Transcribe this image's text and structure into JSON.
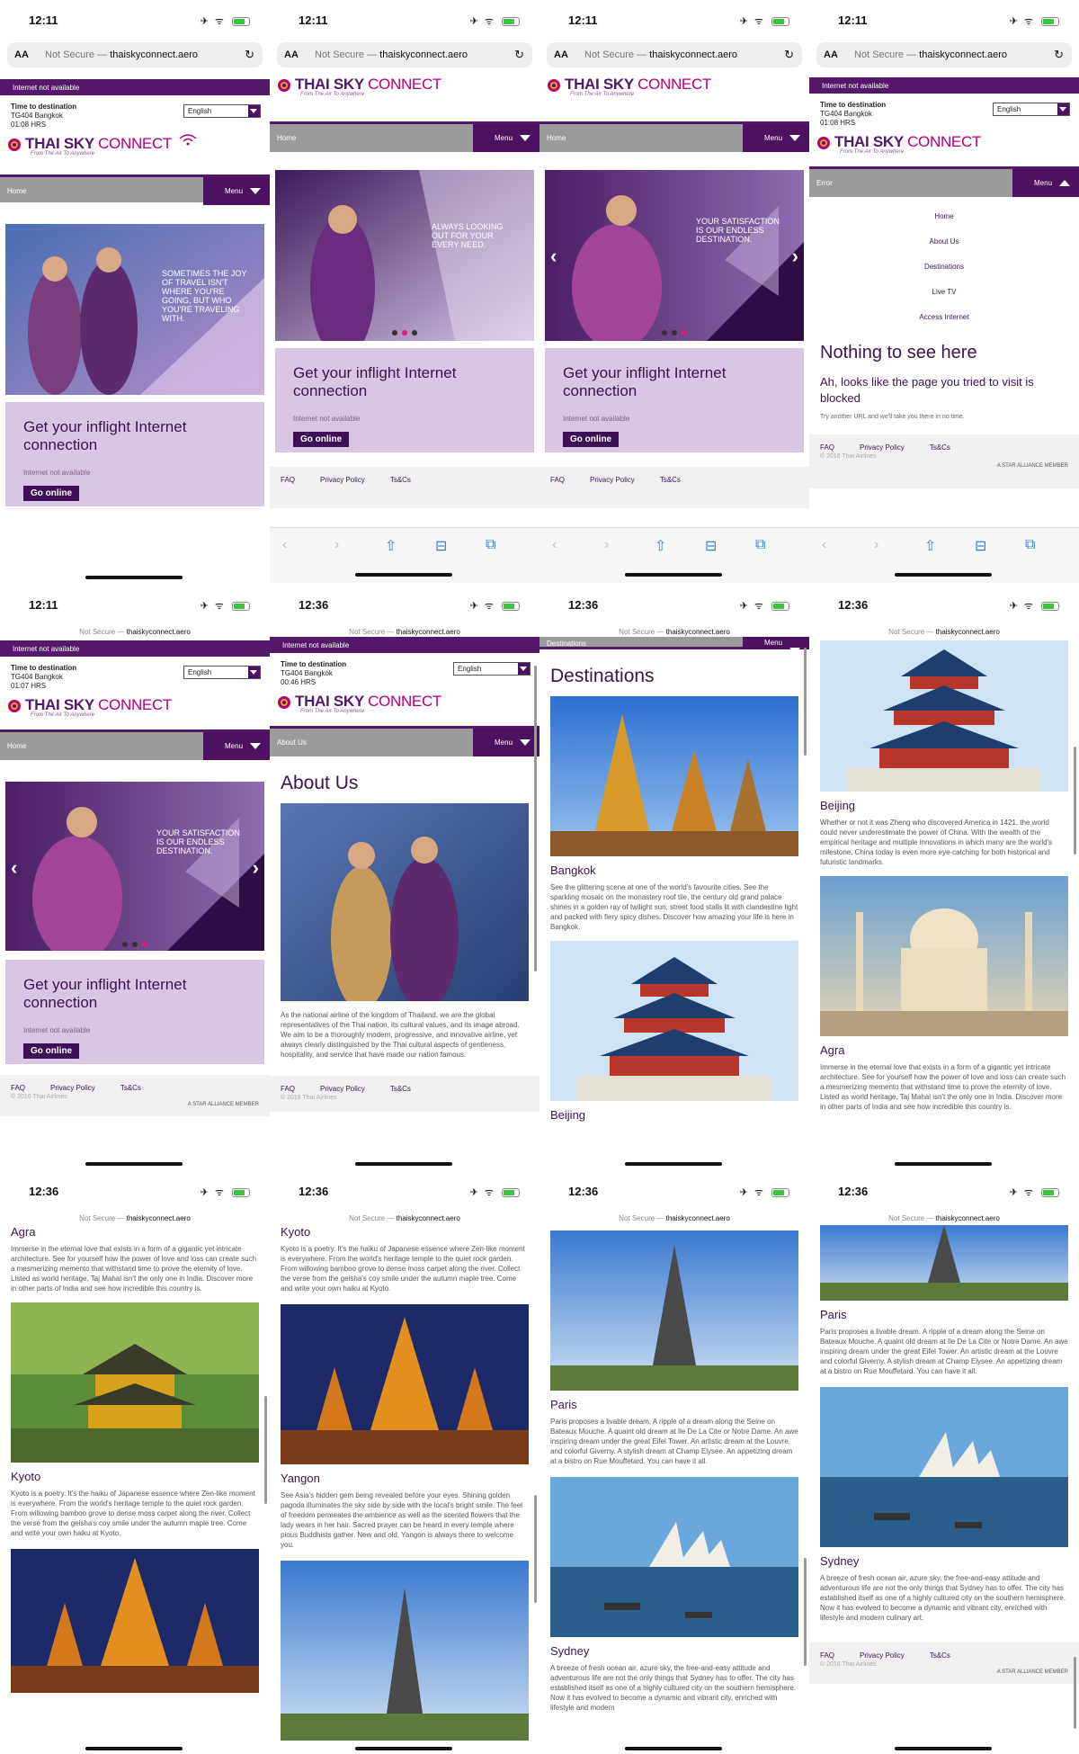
{
  "browser": {
    "not_secure": "Not Secure —",
    "domain": "thaiskyconnect.aero",
    "aa": "AA"
  },
  "status_times": {
    "s1": "12:11",
    "s5": "12:11",
    "s6": "12:36",
    "s7": "12:36",
    "s8": "12:36",
    "s9": "12:36",
    "s10": "12:36",
    "s11": "12:36",
    "s12": "12:36"
  },
  "site": {
    "internet_status": "Internet not available",
    "time_label": "Time to destination",
    "flight": "TG404 Bangkok",
    "hrs_1": "01:08 HRS",
    "hrs_5": "01:07 HRS",
    "hrs_6": "00:46 HRS",
    "language": "English",
    "logo_thai": "THAI SKY ",
    "logo_connect": "CONNECT",
    "logo_tagline": "From The Air To Anywhere",
    "menu": "Menu",
    "crumb_home": "Home",
    "crumb_error": "Error",
    "crumb_about": "About Us",
    "crumb_destinations": "Destinations"
  },
  "hero": {
    "slide1": "Sometimes the joy of travel isn't where you're going, but who you're traveling with.",
    "slide2": "Always looking out for your every need.",
    "slide3": "Your satisfaction is our endless destination."
  },
  "promo": {
    "heading": "Get your inflight Internet connection",
    "status": "Internet not available",
    "button": "Go online"
  },
  "footer": {
    "faq": "FAQ",
    "privacy": "Privacy Policy",
    "terms": "Ts&Cs",
    "copyright": "© 2016 Thai Airlines",
    "alliance": "A STAR ALLIANCE MEMBER"
  },
  "error_menu": [
    "Home",
    "About Us",
    "Destinations",
    "Live TV",
    "Access Internet"
  ],
  "error": {
    "title": "Nothing to see here",
    "message": "Ah, looks like the page you tried to visit is blocked",
    "hint": "Try another URL and we'll take you there in no time."
  },
  "about": {
    "title": "About Us",
    "text": "As the national airline of the kingdom of Thailand, we are the global representatives of the Thai nation, its cultural values, and its image abroad. We aim to be a thoroughly modern, progressive, and innovative airline, yet always clearly distinguished by the Thai cultural aspects of gentleness, hospitality, and service that have made our nation famous."
  },
  "destinations": {
    "title": "Destinations",
    "bangkok": {
      "name": "Bangkok",
      "text": "See the glittering scene at one of the world's favourite cities. See the sparkling mosaic on the monastery roof tile, the century old grand palace shines in a golden ray of twilight sun, street food stalls lit with clandestine light and packed with fiery spicy dishes. Discover how amazing your life is here in Bangkok."
    },
    "beijing": {
      "name": "Beijing",
      "text": "Whether or not it was Zheng who discovered America in 1421, the world could never underestimate the power of China. With the wealth of the empirical heritage and multiple innovations in which many are the world's milestone, China today is even more eye-catching for both historical and futuristic landmarks."
    },
    "agra": {
      "name": "Agra",
      "text": "Immerse in the eternal love that exists in a form of a gigantic yet intricate architecture. See for yourself how the power of love and loss can create such a mesmerizing memento that withstand time to prove the eternity of love. Listed as world heritage, Taj Mahal isn't the only one in India. Discover more in other parts of India and see how incredible this country is."
    },
    "kyoto": {
      "name": "Kyoto",
      "text": "Kyoto is a poetry. It's the haiku of Japanese essence where Zen-like moment is everywhere. From the world's heritage temple to the quiet rock garden. From willowing bamboo grove to dense moss carpet along the river. Collect the verse from the geisha's coy smile under the autumn maple tree. Come and write your own haiku at Kyoto."
    },
    "yangon": {
      "name": "Yangon",
      "text": "See Asia's hidden gem being revealed before your eyes. Shining golden pagoda illuminates the sky side by side with the local's bright smile. The feel of freedom permeates the ambience as well as the scented flowers that the lady wears in her hair. Sacred prayer can be heard in every temple where pious Buddhists gather. New and old, Yangon is always there to welcome you."
    },
    "paris": {
      "name": "Paris",
      "text": "Paris proposes a livable dream. A ripple of a dream along the Seine on Bateaux Mouche. A quaint old dream at Ile De La Cite or Notre Dame. An awe inspiring dream under the great Eifel Tower. An artistic dream at the Louvre and colorful Giverny. A stylish dream at Champ Elysee. An appetizing dream at a bistro on Rue Mouffetard. You can have it all."
    },
    "sydney": {
      "name": "Sydney",
      "text": "A breeze of fresh ocean air, azure sky, the free-and-easy attitude and adventurous life are not the only things that Sydney has to offer. The city has established itself as one of a highly cultured city on the southern hemisphere. Now it has evolved to become a dynamic and vibrant city, enriched with lifestyle and modern culinary art."
    },
    "sydney_cut": "A breeze of fresh ocean air, azure sky, the free-and-easy attitude and adventurous life are not the only things that Sydney has to offer. The city has established itself as one of a highly cultured city on the southern hemisphere. Now it has evolved to become a dynamic and vibrant city, enriched with lifestyle and modern"
  },
  "icons": {
    "back": "chevron-left-icon",
    "forward": "chevron-right-icon",
    "share": "share-icon",
    "bookmarks": "book-icon",
    "tabs": "tabs-icon"
  },
  "colors": {
    "brand_purple": "#54186a",
    "menu_purple": "#4c1160",
    "promo_lilac": "#d9c6e3",
    "accent_pink": "#b1007a"
  }
}
